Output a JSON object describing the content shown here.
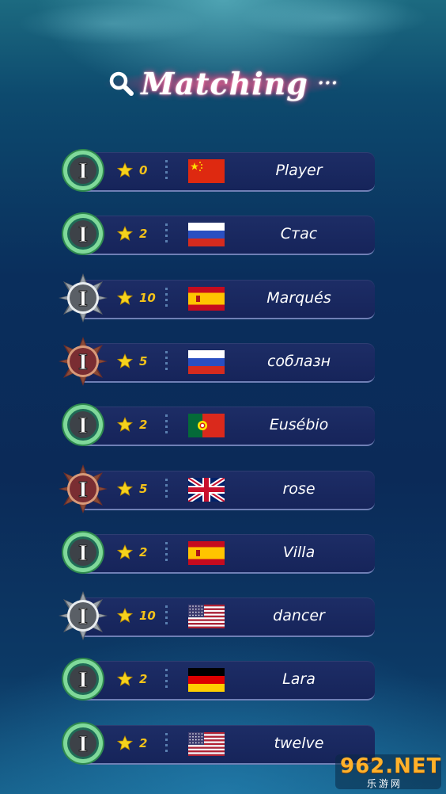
{
  "header": {
    "title": "Matching",
    "ellipsis": "···"
  },
  "players": [
    {
      "stars": "0",
      "name": "Player",
      "flag": "china",
      "badge": "green"
    },
    {
      "stars": "2",
      "name": "Стас",
      "flag": "russia",
      "badge": "green"
    },
    {
      "stars": "10",
      "name": "Marqués",
      "flag": "spain",
      "badge": "silver"
    },
    {
      "stars": "5",
      "name": "соблазн",
      "flag": "russia",
      "badge": "bronze"
    },
    {
      "stars": "2",
      "name": "Eusébio",
      "flag": "portugal",
      "badge": "green"
    },
    {
      "stars": "5",
      "name": "rose",
      "flag": "uk",
      "badge": "bronze"
    },
    {
      "stars": "2",
      "name": "Villa",
      "flag": "spain",
      "badge": "green"
    },
    {
      "stars": "10",
      "name": "dancer",
      "flag": "usa",
      "badge": "silver"
    },
    {
      "stars": "2",
      "name": "Lara",
      "flag": "germany",
      "badge": "green"
    },
    {
      "stars": "2",
      "name": "twelve",
      "flag": "usa",
      "badge": "green"
    }
  ],
  "rank_letter": "I",
  "watermark": {
    "top": "962.NET",
    "bottom": "乐游网"
  },
  "colors": {
    "star": "#f3c21a",
    "bar": "#1d2d66",
    "title_glow": "#ff4f8c"
  }
}
